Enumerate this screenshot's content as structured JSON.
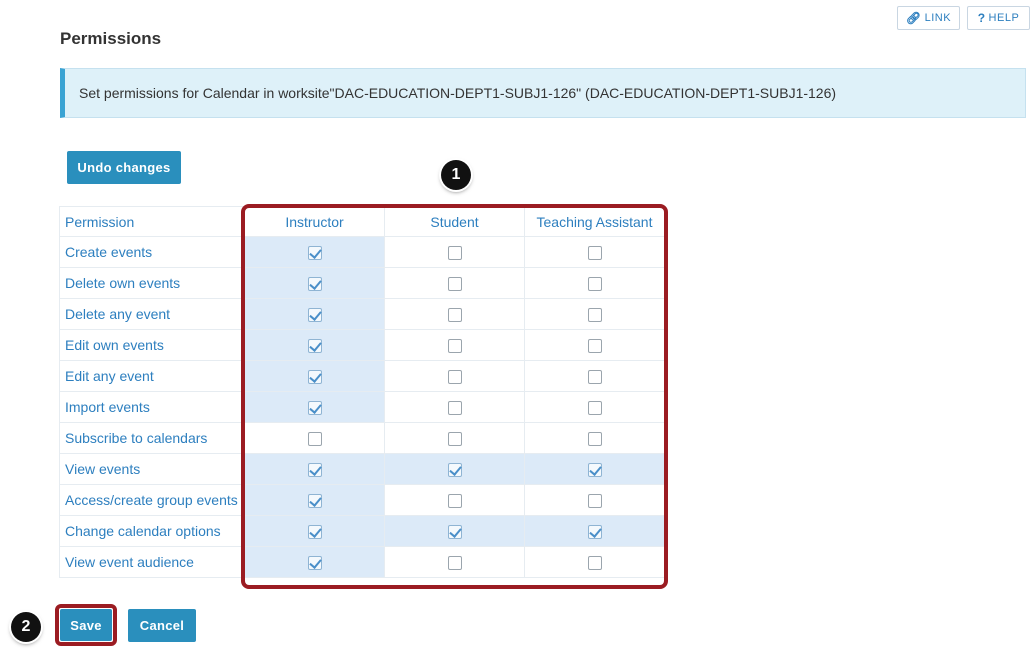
{
  "page": {
    "title": "Permissions"
  },
  "toolbar": {
    "link_label": "LINK",
    "help_label": "HELP"
  },
  "info": {
    "message": "Set permissions for Calendar in worksite\"DAC-EDUCATION-DEPT1-SUBJ1-126\" (DAC-EDUCATION-DEPT1-SUBJ1-126)"
  },
  "actions": {
    "undo_label": "Undo changes",
    "save_label": "Save",
    "cancel_label": "Cancel"
  },
  "table": {
    "headers": [
      "Permission",
      "Instructor",
      "Student",
      "Teaching Assistant"
    ],
    "rows": [
      {
        "label": "Create events",
        "checked": [
          true,
          false,
          false
        ]
      },
      {
        "label": "Delete own events",
        "checked": [
          true,
          false,
          false
        ]
      },
      {
        "label": "Delete any event",
        "checked": [
          true,
          false,
          false
        ]
      },
      {
        "label": "Edit own events",
        "checked": [
          true,
          false,
          false
        ]
      },
      {
        "label": "Edit any event",
        "checked": [
          true,
          false,
          false
        ]
      },
      {
        "label": "Import events",
        "checked": [
          true,
          false,
          false
        ]
      },
      {
        "label": "Subscribe to calendars",
        "checked": [
          false,
          false,
          false
        ]
      },
      {
        "label": "View events",
        "checked": [
          true,
          true,
          true
        ]
      },
      {
        "label": "Access/create group events",
        "checked": [
          true,
          false,
          false
        ]
      },
      {
        "label": "Change calendar options",
        "checked": [
          true,
          true,
          true
        ]
      },
      {
        "label": "View event audience",
        "checked": [
          true,
          false,
          false
        ]
      }
    ]
  },
  "callouts": {
    "one": "1",
    "two": "2"
  },
  "colors": {
    "accent": "#2a8fbd",
    "highlight": "#9b1c22",
    "info_bg": "#def1f9"
  }
}
